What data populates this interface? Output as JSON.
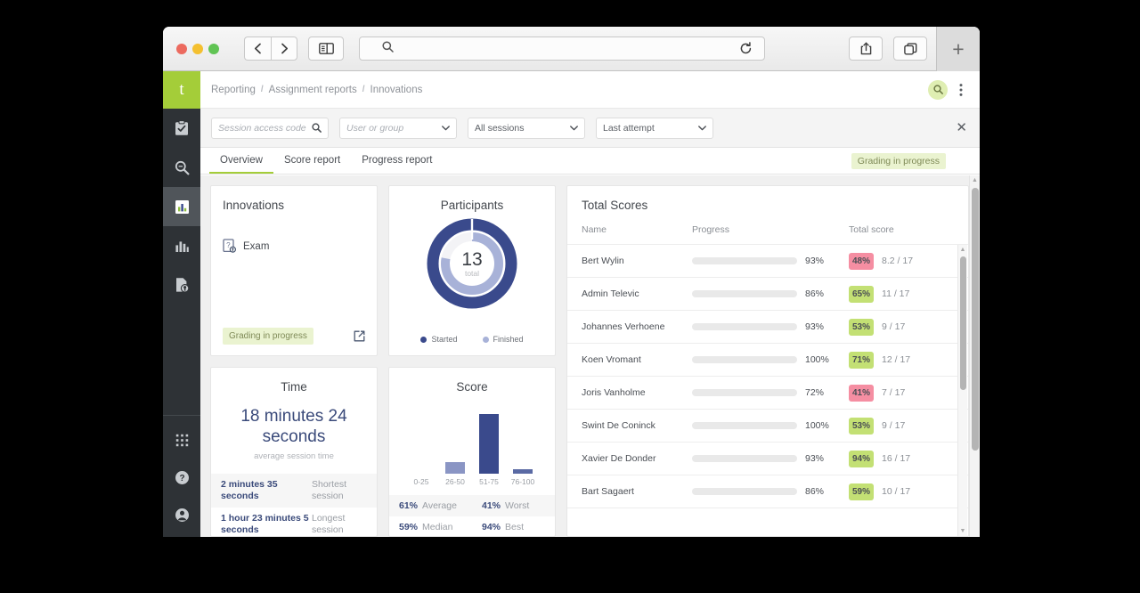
{
  "browser": {
    "back_icon": "chevron-left-icon",
    "forward_icon": "chevron-right-icon",
    "sidebar_icon": "sidebar-toggle-icon",
    "address_value": "",
    "address_placeholder": "",
    "search_icon": "search-icon",
    "reload_icon": "reload-icon",
    "share_icon": "share-icon",
    "tabs_icon": "tabs-icon",
    "new_tab_label": "+"
  },
  "rail": {
    "logo": "t",
    "items": [
      {
        "name": "assignments",
        "icon": "clipboard-check-icon"
      },
      {
        "name": "search",
        "icon": "search-magnifier-icon"
      },
      {
        "name": "reporting",
        "icon": "report-chart-icon",
        "active": true
      },
      {
        "name": "analytics",
        "icon": "bar-chart-icon"
      },
      {
        "name": "content",
        "icon": "document-tag-icon"
      }
    ],
    "bottom_items": [
      {
        "name": "apps",
        "icon": "grid-apps-icon"
      },
      {
        "name": "help",
        "icon": "question-circle-icon"
      },
      {
        "name": "account",
        "icon": "user-circle-icon"
      }
    ]
  },
  "header": {
    "breadcrumb": [
      "Reporting",
      "Assignment reports",
      "Innovations"
    ],
    "separator": "/",
    "search_icon": "search-icon",
    "more_icon": "more-vertical-icon"
  },
  "filters": {
    "access_code_placeholder": "Session access code",
    "access_code_icon": "search-icon",
    "user_group_placeholder": "User or group",
    "user_group_icon": "chevron-down-icon",
    "sessions_value": "All sessions",
    "sessions_icon": "chevron-down-icon",
    "attempt_value": "Last attempt",
    "attempt_icon": "chevron-down-icon",
    "close_icon": "close-icon",
    "close_label": "✕"
  },
  "tabs": {
    "items": [
      "Overview",
      "Score report",
      "Progress report"
    ],
    "active_index": 0,
    "status_badge": "Grading in progress"
  },
  "innovations": {
    "title": "Innovations",
    "item_label": "Exam",
    "item_icon": "exam-document-icon",
    "badge": "Grading in progress",
    "open_icon": "external-link-icon"
  },
  "participants": {
    "title": "Participants",
    "center_value": "13",
    "center_label": "total",
    "legend": [
      {
        "label": "Started",
        "color": "#3a4a8c"
      },
      {
        "label": "Finished",
        "color": "#a8b2d8"
      }
    ],
    "chart_data": {
      "type": "pie",
      "title": "Participants",
      "total": 13,
      "series": [
        {
          "name": "Started",
          "value": 13,
          "fraction": 1.0,
          "color": "#3a4a8c",
          "ring": "outer"
        },
        {
          "name": "Finished",
          "value": 10,
          "fraction": 0.78,
          "color": "#a8b2d8",
          "ring": "inner"
        }
      ],
      "legend_position": "bottom"
    }
  },
  "time": {
    "title": "Time",
    "main_value": "18 minutes 24 seconds",
    "sub_label": "average session time",
    "stats": [
      {
        "value": "2 minutes 35 seconds",
        "label": "Shortest session"
      },
      {
        "value": "1 hour 23 minutes 5 seconds",
        "label": "Longest session"
      }
    ]
  },
  "score": {
    "title": "Score",
    "stats": [
      {
        "value": "61%",
        "label": "Average"
      },
      {
        "value": "41%",
        "label": "Worst"
      },
      {
        "value": "59%",
        "label": "Median"
      },
      {
        "value": "94%",
        "label": "Best"
      }
    ],
    "chart_data": {
      "type": "bar",
      "title": "Score",
      "categories": [
        "0-25",
        "26-50",
        "51-75",
        "76-100"
      ],
      "values": [
        0,
        1,
        5,
        0.4
      ],
      "colors": [
        "#8a95c4",
        "#8a95c4",
        "#3a4a8c",
        "#5a6aa4"
      ],
      "xlabel": "",
      "ylabel": "",
      "ylim": [
        0,
        5.5
      ],
      "grid": false
    }
  },
  "total_scores": {
    "title": "Total Scores",
    "columns": [
      "Name",
      "Progress",
      "Total score"
    ],
    "rows": [
      {
        "name": "Bert Wylin",
        "progress": "93%",
        "progress_value": 93,
        "badge": "48%",
        "badge_state": "fail",
        "fraction": "8.2 / 17"
      },
      {
        "name": "Admin Televic",
        "progress": "86%",
        "progress_value": 86,
        "badge": "65%",
        "badge_state": "pass",
        "fraction": "11 / 17"
      },
      {
        "name": "Johannes Verhoene",
        "progress": "93%",
        "progress_value": 93,
        "badge": "53%",
        "badge_state": "pass",
        "fraction": "9 / 17"
      },
      {
        "name": "Koen Vromant",
        "progress": "100%",
        "progress_value": 100,
        "badge": "71%",
        "badge_state": "pass",
        "fraction": "12 / 17"
      },
      {
        "name": "Joris Vanholme",
        "progress": "72%",
        "progress_value": 72,
        "badge": "41%",
        "badge_state": "fail",
        "fraction": "7 / 17"
      },
      {
        "name": "Swint De Coninck",
        "progress": "100%",
        "progress_value": 100,
        "badge": "53%",
        "badge_state": "pass",
        "fraction": "9 / 17"
      },
      {
        "name": "Xavier De Donder",
        "progress": "93%",
        "progress_value": 93,
        "badge": "94%",
        "badge_state": "pass",
        "fraction": "16 / 17"
      },
      {
        "name": "Bart Sagaert",
        "progress": "86%",
        "progress_value": 86,
        "badge": "59%",
        "badge_state": "pass",
        "fraction": "10 / 17"
      }
    ]
  },
  "colors": {
    "brand_green": "#a4cd39",
    "badge_green": "#c3e074",
    "badge_pink": "#f58ea2",
    "bar_green": "#b8da6e",
    "navy": "#3a4a8c",
    "rail_dark": "#2e3236"
  }
}
